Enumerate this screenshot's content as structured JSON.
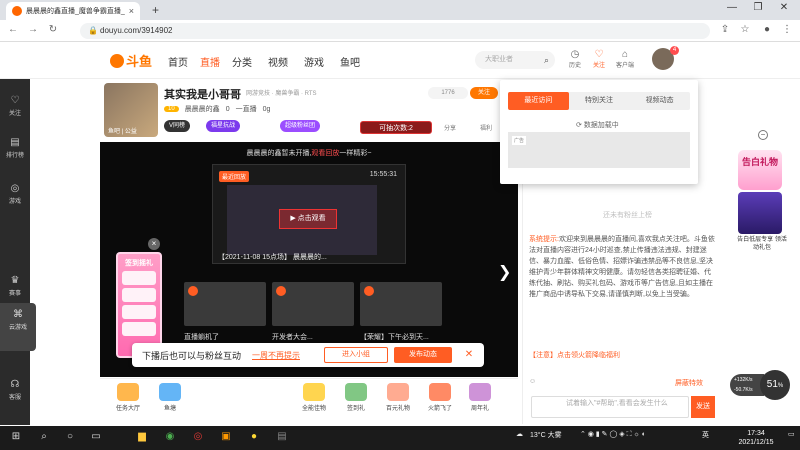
{
  "browser": {
    "tab_title": "晨晨晨的鑫直播_魔兽争霸直播_斗鱼直播",
    "tab_close": "×",
    "new_tab": "+",
    "url": "douyu.com/3914902",
    "win_min": "—",
    "win_max": "❐",
    "win_close": "✕"
  },
  "header": {
    "logo": "斗鱼",
    "nav": [
      "首页",
      "直播",
      "分类",
      "视频",
      "游戏",
      "鱼吧"
    ],
    "search_placeholder": "大职业者",
    "icons": [
      {
        "label": "历史"
      },
      {
        "label": "关注"
      },
      {
        "label": "客户端"
      }
    ],
    "avatar_badge": "4"
  },
  "leftbar": {
    "items": [
      {
        "icon": "heart-icon",
        "label": "关注"
      },
      {
        "icon": "rank-icon",
        "label": "排行榜"
      },
      {
        "icon": "game-icon",
        "label": "游戏"
      },
      {
        "icon": "gamepad-icon",
        "label": "云游戏"
      },
      {
        "icon": "trophy-icon",
        "label": "赛事"
      },
      {
        "icon": "headset-icon",
        "label": "客服"
      }
    ]
  },
  "room": {
    "title": "其实我是小哥哥",
    "meta": "网游竞技 · 魔兽争霸 · RTS",
    "level": "10",
    "streamer": "晨晨晨的鑫",
    "stats": [
      "0",
      "一直播",
      "0g"
    ],
    "follow_count": "1776",
    "follow_btn": "关注",
    "av_label": "鱼吧 | 公益",
    "pills": [
      "V同榜",
      "福星抗战",
      "超级粉丝团"
    ],
    "draw_btn": "可抽次数:2",
    "share": "分享",
    "welfare": "福利"
  },
  "video": {
    "head_text": "晨晨晨的鑫暂未开播,",
    "head_highlight": "观看回放",
    "head_tail": "一样精彩~",
    "preview_tag": "最近回放",
    "preview_time": "15:55:31",
    "preview_btn": "▶ 点击观看",
    "preview_caption": "【2021-11-08 15点场】 晨晨晨的...",
    "thumbs": [
      "直播躺机了",
      "开发者大会...",
      "【荣耀】下午必到天..."
    ],
    "signin_title": "签到摇礼",
    "close_x": "×",
    "arrow": "❯"
  },
  "follow_bar": {
    "text": "下播后也可以与粉丝互动",
    "link": "一周不再提示",
    "btn1": "进入小组",
    "btn2": "发布动态",
    "close": "✕"
  },
  "gifts": [
    {
      "label": "任务大厅",
      "color": "#ffb74d"
    },
    {
      "label": "鱼塘",
      "color": "#64b5f6"
    },
    {
      "label": "全能佳物",
      "color": "#ffd54f"
    },
    {
      "label": "签到礼",
      "color": "#81c784"
    },
    {
      "label": "百元礼物",
      "color": "#ffab91"
    },
    {
      "label": "火箭飞了",
      "color": "#ff8a65"
    },
    {
      "label": "周年礼",
      "color": "#ce93d8"
    }
  ],
  "dropdown": {
    "tabs": [
      "最近访问",
      "特别关注",
      "视频动态"
    ],
    "loading": "数据加载中",
    "card_tag": "广告"
  },
  "rightpanel": {
    "rank_text": "还未有粉丝上榜",
    "note_label": "系统提示:",
    "note_text": "欢迎来到晨晨晨的直播间,喜欢我点关注吧。斗鱼依法对直播内容进行24小时巡查,禁止传播违法违规、封建迷信、暴力血腥、低俗色情、招嫖诈骗违禁品等不良信息,坚决维护青少年群体精神文明健康。请勿轻信各类招聘征婚、代练代抽、刷钻、购买礼包码、游戏币等广告信息,且如主播在推广商品中诱导私下交易,请谨慎判断,以免上当受骗。",
    "warn": "【注意】点击领火箭降临福利",
    "tools_right": "屏蔽特效",
    "chat_placeholder": "试着输入\"#帮助\",看看会发生什么",
    "send": "发送"
  },
  "float": {
    "card_text": "告白礼物",
    "card2_caption": "告白低层专享 领活动礼包",
    "close": "−",
    "speed": "51",
    "speed_line1": "+132K/s",
    "speed_line2": "-50.7K/s"
  },
  "taskbar": {
    "weather": "13°C 大雾",
    "time": "17:34",
    "date": "2021/12/15",
    "lang": "英"
  }
}
